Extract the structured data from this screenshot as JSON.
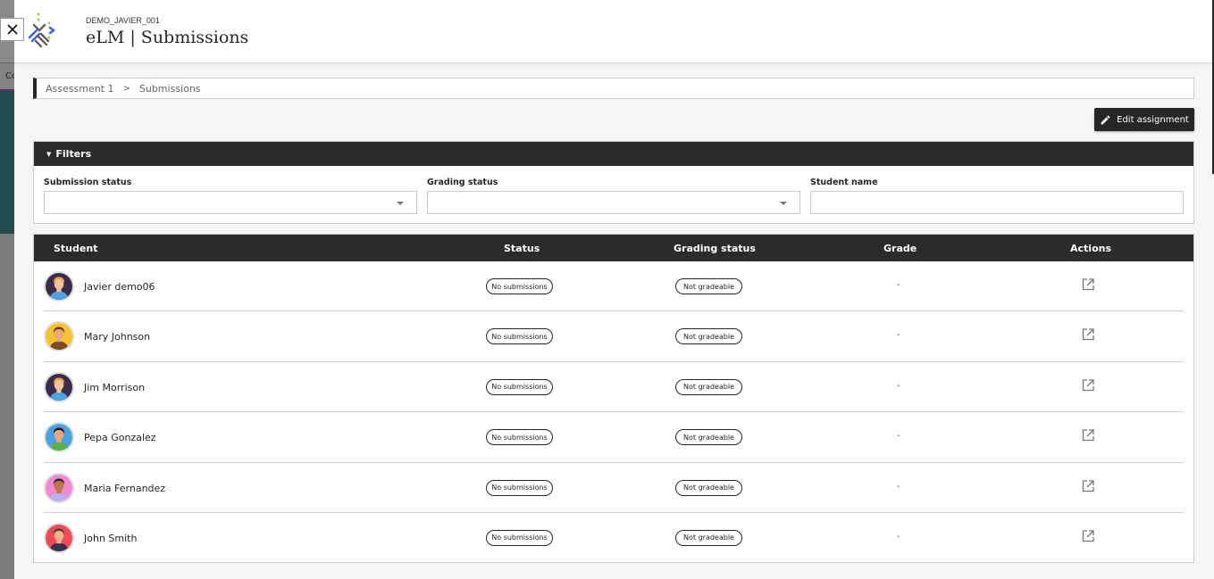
{
  "header": {
    "course_code": "DEMO_JAVIER_001",
    "title": "eLM | Submissions",
    "logo_icon": "elm-logo-icon",
    "close_icon": "close-icon"
  },
  "background": {
    "tab_text": "Co"
  },
  "breadcrumb": {
    "items": [
      "Assessment 1",
      "Submissions"
    ],
    "separator": ">"
  },
  "toolbar": {
    "edit_label": "Edit assignment",
    "edit_icon": "pencil-icon"
  },
  "filters": {
    "title": "Filters",
    "fields": [
      {
        "label": "Submission status",
        "value": "",
        "type": "select"
      },
      {
        "label": "Grading status",
        "value": "",
        "type": "select"
      },
      {
        "label": "Student name",
        "value": "",
        "type": "text"
      }
    ]
  },
  "table": {
    "columns": [
      "Student",
      "Status",
      "Grading status",
      "Grade",
      "Actions"
    ],
    "rows": [
      {
        "name": "Javier demo06",
        "status": "No submissions",
        "grading": "Not gradeable",
        "grade": "-",
        "avatar": {
          "bg": "#3b2a4a",
          "skin": "#f2c29a",
          "hair": "#e8a24a",
          "shirt": "#4aa3e0"
        }
      },
      {
        "name": "Mary Johnson",
        "status": "No submissions",
        "grading": "Not gradeable",
        "grade": "-",
        "avatar": {
          "bg": "#f5c232",
          "skin": "#e8a87c",
          "hair": "#6b3a1e",
          "shirt": "#7a4a2a"
        }
      },
      {
        "name": "Jim Morrison",
        "status": "No submissions",
        "grading": "Not gradeable",
        "grade": "-",
        "avatar": {
          "bg": "#3b2a4a",
          "skin": "#f2c29a",
          "hair": "#e8a24a",
          "shirt": "#4aa3e0"
        }
      },
      {
        "name": "Pepa Gonzalez",
        "status": "No submissions",
        "grading": "Not gradeable",
        "grade": "-",
        "avatar": {
          "bg": "#4aa3e0",
          "skin": "#e8a87c",
          "hair": "#2a1e2a",
          "shirt": "#5aae4a"
        }
      },
      {
        "name": "Maria Fernandez",
        "status": "No submissions",
        "grading": "Not gradeable",
        "grade": "-",
        "avatar": {
          "bg": "#f08ad0",
          "skin": "#b8784a",
          "hair": "#3a2a3a",
          "shirt": "#b8b0f0"
        }
      },
      {
        "name": "John Smith",
        "status": "No submissions",
        "grading": "Not gradeable",
        "grade": "-",
        "avatar": {
          "bg": "#f04a5a",
          "skin": "#f0b08a",
          "hair": "#5a3a2a",
          "shirt": "#3a3050"
        }
      }
    ],
    "action_icon": "open-external-icon"
  },
  "colors": {
    "header_dark": "#2b2b2b",
    "logo_blue": "#3a66d8",
    "logo_gray": "#6a6060",
    "logo_green": "#9ad04a"
  }
}
